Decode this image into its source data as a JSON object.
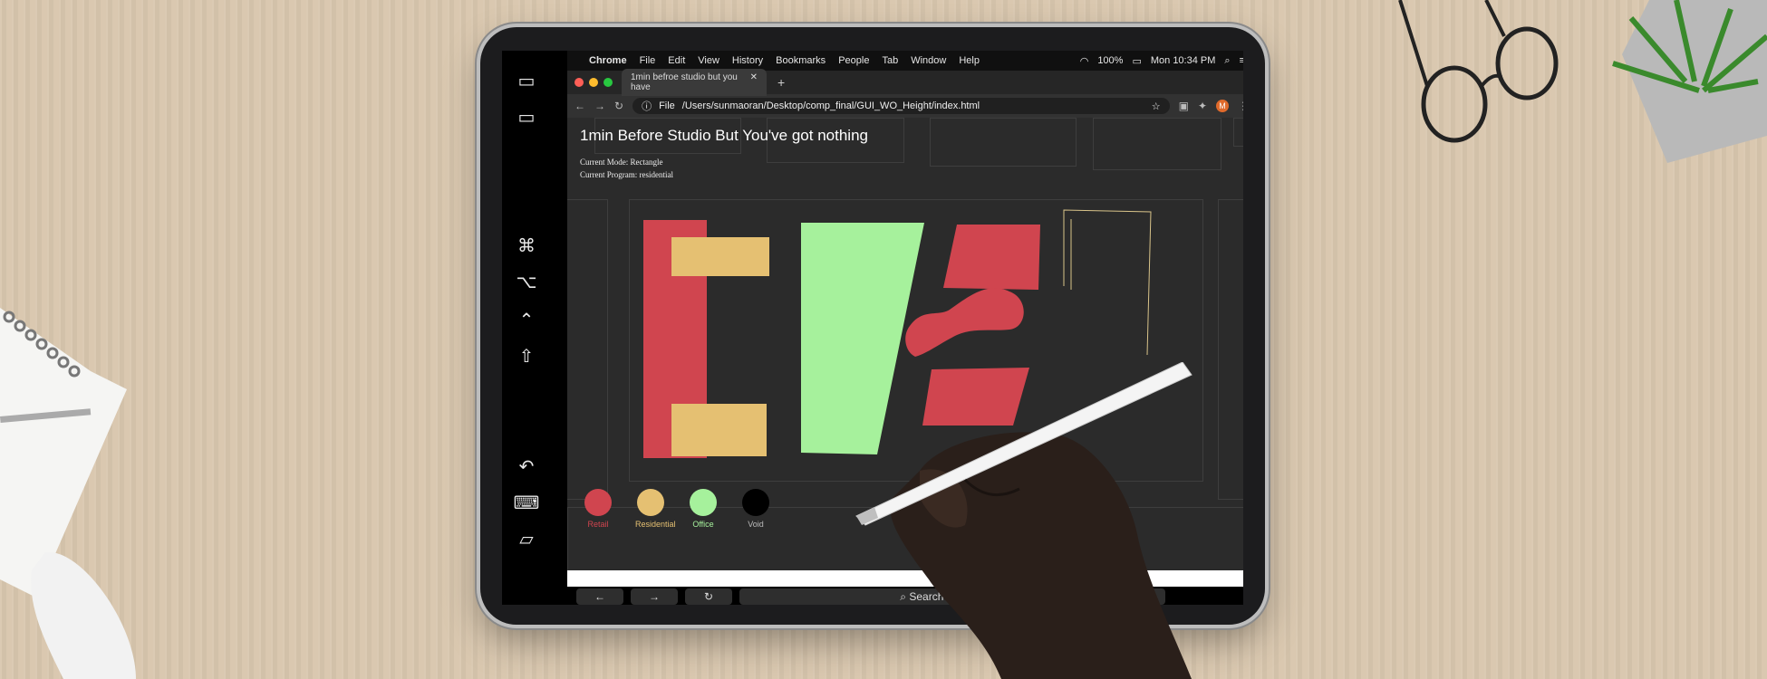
{
  "menubar": {
    "app": "Chrome",
    "items": [
      "File",
      "Edit",
      "View",
      "History",
      "Bookmarks",
      "People",
      "Tab",
      "Window",
      "Help"
    ],
    "battery": "100%",
    "clock": "Mon 10:34 PM"
  },
  "browser": {
    "tab_title": "1min befroe studio but you have",
    "url_prefix": "File",
    "url": "/Users/sunmaoran/Desktop/comp_final/GUI_WO_Height/index.html",
    "profile_initial": "M"
  },
  "page": {
    "title": "1min Before Studio But You've got nothing",
    "mode": "Current Mode: Rectangle",
    "program": "Current Program: residential"
  },
  "programs": [
    {
      "label": "Retail",
      "color": "#d0454f",
      "label_color": "#d0454f"
    },
    {
      "label": "Residential",
      "color": "#e5c072",
      "label_color": "#e5c072"
    },
    {
      "label": "Office",
      "color": "#a6f19c",
      "label_color": "#a6f19c"
    },
    {
      "label": "Void",
      "color": "#000000",
      "label_color": "#bbbbbb"
    }
  ],
  "ipad_bottom": {
    "search_placeholder": "Search or type URL"
  },
  "colors": {
    "retail": "#d0454f",
    "residential": "#e5c072",
    "office": "#a6f19c",
    "outline": "#d9c48a"
  }
}
